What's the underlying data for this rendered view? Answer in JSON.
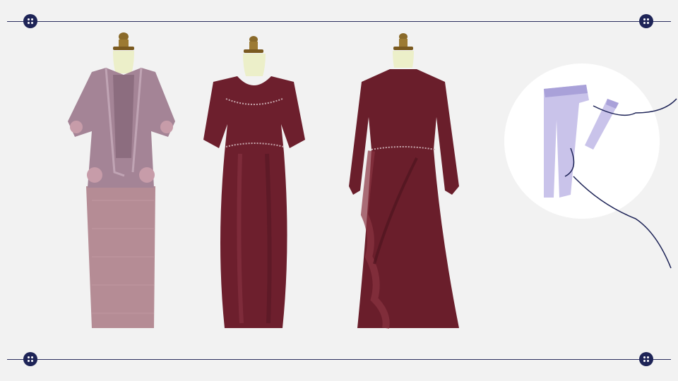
{
  "slide": {
    "background": "#f2f2f2",
    "line_color": "#2b2f5e",
    "button_color": "#1e2457"
  },
  "garments": [
    {
      "name": "kebaya-outfit",
      "top_color": "#a48496",
      "skirt_color": "#b58c95"
    },
    {
      "name": "satin-dress-short-sleeve",
      "color": "#6d1f2d"
    },
    {
      "name": "satin-ruffle-dress",
      "color": "#6a1e2b"
    }
  ],
  "decoration": {
    "circle_color": "#ffffff",
    "pants_color": "#c9c3ea",
    "pants_shadow": "#a9a1d9",
    "thread_color": "#1e2457"
  }
}
